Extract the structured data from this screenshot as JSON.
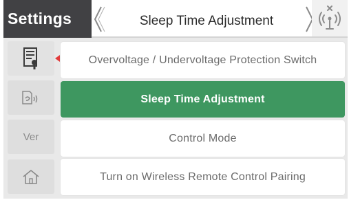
{
  "header": {
    "section_title": "Settings",
    "page_title": "Sleep Time Adjustment"
  },
  "sidebar": {
    "items": [
      {
        "icon": "document-settings-icon",
        "label": ""
      },
      {
        "icon": "hand-remote-icon",
        "label": ""
      },
      {
        "icon": "version-icon",
        "label": "Ver"
      },
      {
        "icon": "home-icon",
        "label": ""
      }
    ]
  },
  "menu": {
    "items": [
      {
        "label": "Overvoltage / Undervoltage Protection Switch",
        "selected": false
      },
      {
        "label": "Sleep Time Adjustment",
        "selected": true
      },
      {
        "label": "Control Mode",
        "selected": false
      },
      {
        "label": "Turn on Wireless Remote Control Pairing",
        "selected": false
      }
    ]
  },
  "colors": {
    "header_dark": "#414144",
    "selected_green": "#3e9760",
    "marker_red": "#e23a3a"
  }
}
